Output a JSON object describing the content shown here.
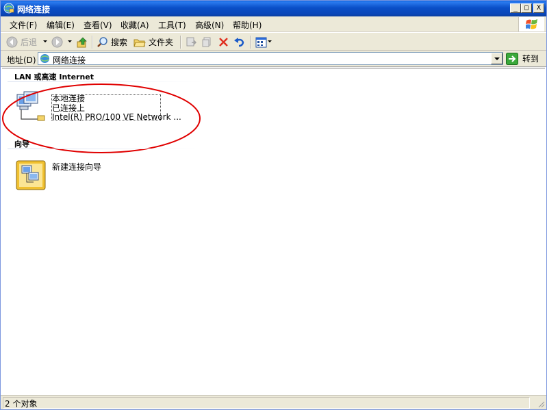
{
  "window": {
    "title": "网络连接",
    "buttons": {
      "minimize": "_",
      "maximize": "□",
      "close": "X"
    }
  },
  "menu": {
    "items": [
      "文件(F)",
      "编辑(E)",
      "查看(V)",
      "收藏(A)",
      "工具(T)",
      "高级(N)",
      "帮助(H)"
    ]
  },
  "toolbar": {
    "back_label": "后退",
    "search_label": "搜索",
    "folders_label": "文件夹"
  },
  "address": {
    "label": "地址(D)",
    "value": "网络连接",
    "go_label": "转到"
  },
  "groups": [
    {
      "heading": "LAN 或高速 Internet",
      "items": [
        {
          "name": "本地连接",
          "status": "已连接上",
          "device": "Intel(R) PRO/100 VE Network ..."
        }
      ]
    },
    {
      "heading": "向导",
      "items": [
        {
          "name": "新建连接向导"
        }
      ]
    }
  ],
  "status": {
    "text": "2 个对象"
  },
  "colors": {
    "titlebar": "#0a4fc8",
    "annotation_circle": "#e00000",
    "chrome": "#ece9d8"
  }
}
